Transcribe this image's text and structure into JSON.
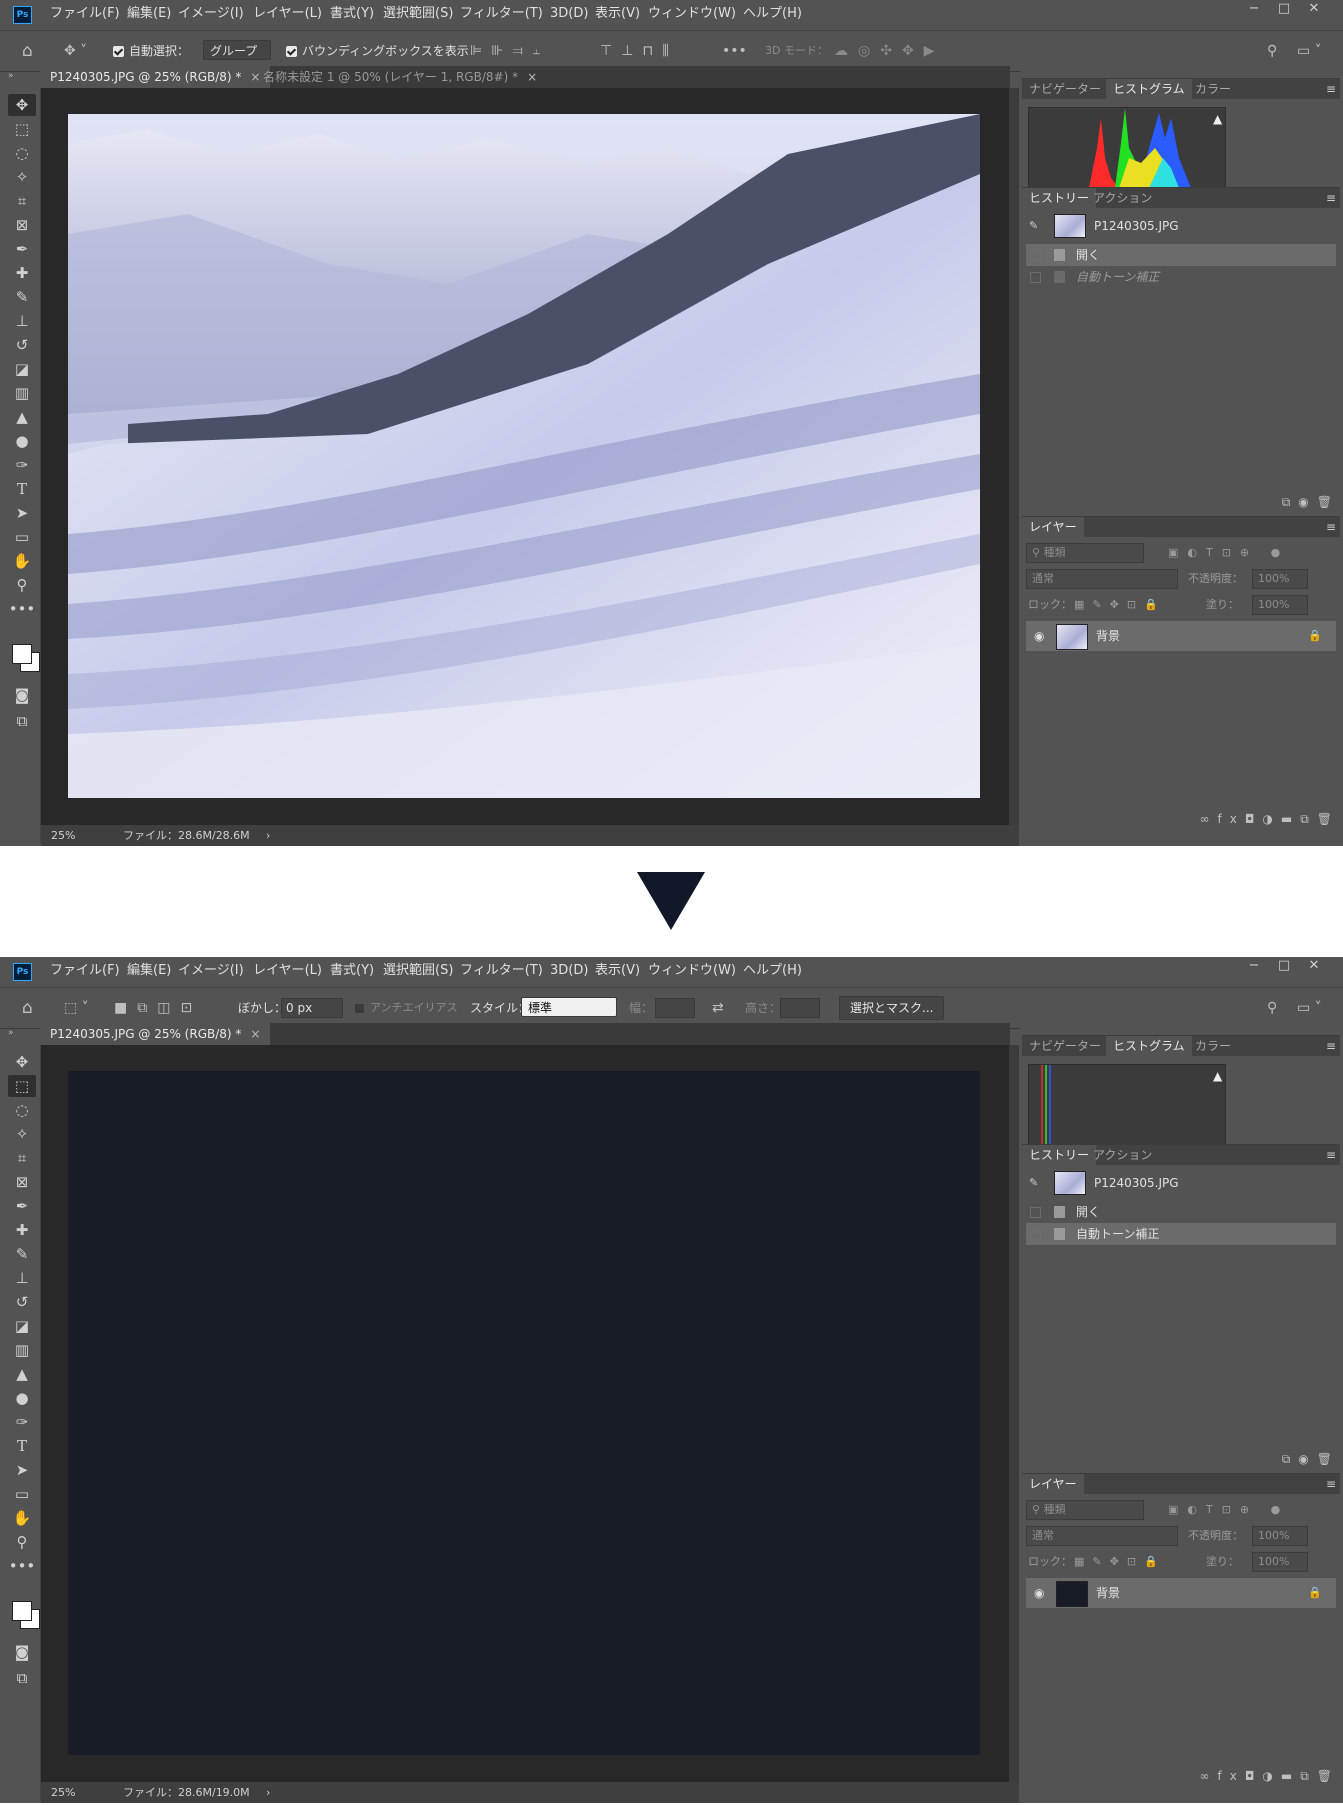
{
  "app": {
    "logo": "Ps"
  },
  "menu": [
    "ファイル(F)",
    "編集(E)",
    "イメージ(I)",
    "レイヤー(L)",
    "書式(Y)",
    "選択範囲(S)",
    "フィルター(T)",
    "3D(D)",
    "表示(V)",
    "ウィンドウ(W)",
    "ヘルプ(H)"
  ],
  "window_buttons": [
    "−",
    "□",
    "✕"
  ],
  "before": {
    "options": {
      "auto_select_label": "自動選択：",
      "auto_select_value": "グループ",
      "bbox_label": "バウンディングボックスを表示",
      "mode_3d": "3D モード："
    },
    "tabs": [
      {
        "label": "P1240305.JPG @ 25% (RGB/8) *"
      },
      {
        "label": "名称未設定 1 @ 50% (レイヤー 1, RGB/8#) *"
      }
    ],
    "status": {
      "zoom": "25%",
      "file": "ファイル：28.6M/28.6M"
    },
    "history": {
      "snapshot": "P1240305.JPG",
      "items": [
        {
          "label": "開く",
          "state": "selected"
        },
        {
          "label": "自動トーン補正",
          "state": "undone"
        }
      ]
    },
    "layer_name": "背景"
  },
  "after": {
    "options": {
      "feather_label": "ぼかし：",
      "feather_value": "0 px",
      "antialias": "アンチエイリアス",
      "style_label": "スタイル：",
      "style_value": "標準",
      "width_label": "幅：",
      "height_label": "高さ：",
      "mask_button": "選択とマスク..."
    },
    "tabs": [
      {
        "label": "P1240305.JPG @ 25% (RGB/8) *"
      }
    ],
    "status": {
      "zoom": "25%",
      "file": "ファイル：28.6M/19.0M"
    },
    "history": {
      "snapshot": "P1240305.JPG",
      "items": [
        {
          "label": "開く",
          "state": "normal"
        },
        {
          "label": "自動トーン補正",
          "state": "selected"
        }
      ]
    },
    "layer_name": "背景"
  },
  "panels": {
    "top_tabs": [
      "ナビゲーター",
      "ヒストグラム",
      "カラー"
    ],
    "history_tabs": [
      "ヒストリー",
      "アクション"
    ],
    "layers_tab": "レイヤー",
    "kind_placeholder": "種類",
    "blend_mode": "通常",
    "opacity_label": "不透明度：",
    "opacity_value": "100%",
    "lock_label": "ロック：",
    "fill_label": "塗り：",
    "fill_value": "100%",
    "warning_glyph": "▲",
    "menu_glyph": "≡"
  },
  "colors": {
    "ui_bg": "#535353",
    "canvas_bg": "#282828",
    "dark_image": "#181c27",
    "arrow": "#111827"
  },
  "icons": [
    "home-icon",
    "move-icon",
    "marquee-icon",
    "lasso-icon",
    "magic-wand-icon",
    "crop-icon",
    "frame-icon",
    "eyedropper-icon",
    "healing-icon",
    "brush-icon",
    "stamp-icon",
    "history-brush-icon",
    "eraser-icon",
    "gradient-icon",
    "blur-icon",
    "dodge-icon",
    "pen-icon",
    "type-icon",
    "path-select-icon",
    "rectangle-icon",
    "hand-icon",
    "zoom-icon",
    "more-icon",
    "search-icon",
    "workspace-icon",
    "eye-icon",
    "lock-icon",
    "trash-icon",
    "camera-icon"
  ]
}
